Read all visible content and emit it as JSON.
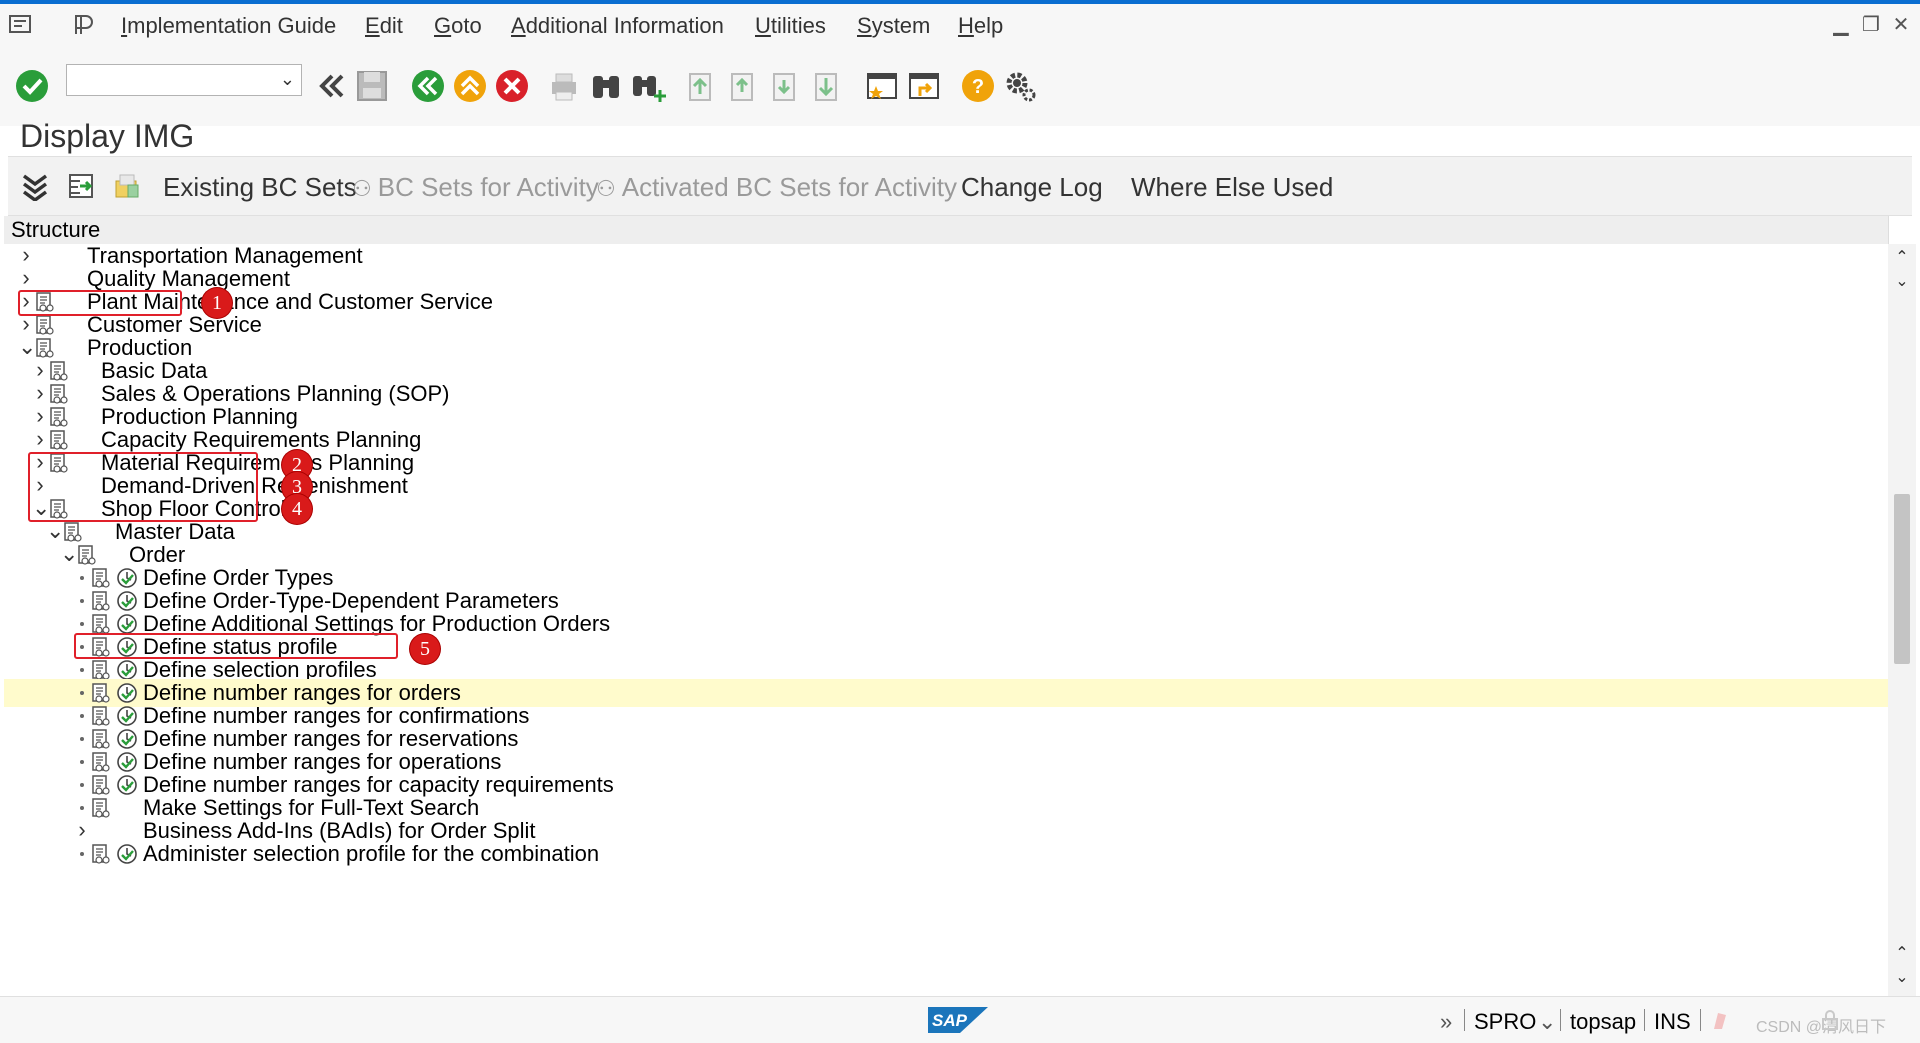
{
  "menu": {
    "items": [
      "Implementation Guide",
      "Edit",
      "Goto",
      "Additional Information",
      "Utilities",
      "System",
      "Help"
    ]
  },
  "icons": {
    "menu_toggle": "menu-icon",
    "sap_menu": "sap-p-icon",
    "enter": "green-check-icon",
    "back": "green-back-icon",
    "exit": "yellow-up-icon",
    "cancel": "red-cancel-icon",
    "help": "yellow-help-icon",
    "settings": "gear-icon"
  },
  "command_field": {
    "value": ""
  },
  "page_title": "Display IMG",
  "app_toolbar": {
    "existing_bc_sets": "Existing BC Sets",
    "bc_sets_for_activity": "BC Sets for Activity",
    "activated_bc_sets": "Activated BC Sets for Activity",
    "change_log": "Change Log",
    "where_else_used": "Where Else Used"
  },
  "structure": {
    "header": "Structure",
    "nodes": [
      {
        "label": "Transportation Management",
        "level": 0,
        "state": "collapsed",
        "doc": false,
        "clock": false
      },
      {
        "label": "Quality Management",
        "level": 0,
        "state": "collapsed",
        "doc": false,
        "clock": false
      },
      {
        "label": "Plant Maintenance and Customer Service",
        "level": 0,
        "state": "collapsed",
        "doc": true,
        "clock": false
      },
      {
        "label": "Customer Service",
        "level": 0,
        "state": "collapsed",
        "doc": true,
        "clock": false
      },
      {
        "label": "Production",
        "level": 0,
        "state": "expanded",
        "doc": true,
        "clock": false
      },
      {
        "label": "Basic Data",
        "level": 1,
        "state": "collapsed",
        "doc": true,
        "clock": false
      },
      {
        "label": "Sales & Operations Planning (SOP)",
        "level": 1,
        "state": "collapsed",
        "doc": true,
        "clock": false
      },
      {
        "label": "Production Planning",
        "level": 1,
        "state": "collapsed",
        "doc": true,
        "clock": false
      },
      {
        "label": "Capacity Requirements Planning",
        "level": 1,
        "state": "collapsed",
        "doc": true,
        "clock": false
      },
      {
        "label": "Material Requirements Planning",
        "level": 1,
        "state": "collapsed",
        "doc": true,
        "clock": false
      },
      {
        "label": "Demand-Driven Replenishment",
        "level": 1,
        "state": "collapsed",
        "doc": false,
        "clock": false
      },
      {
        "label": "Shop Floor Control",
        "level": 1,
        "state": "expanded",
        "doc": true,
        "clock": false
      },
      {
        "label": "Master Data",
        "level": 2,
        "state": "expanded",
        "doc": true,
        "clock": false
      },
      {
        "label": "Order",
        "level": 3,
        "state": "expanded",
        "doc": true,
        "clock": false
      },
      {
        "label": "Define Order Types",
        "level": 4,
        "state": "leaf",
        "doc": true,
        "clock": true
      },
      {
        "label": "Define Order-Type-Dependent Parameters",
        "level": 4,
        "state": "leaf",
        "doc": true,
        "clock": true
      },
      {
        "label": "Define Additional Settings for Production Orders",
        "level": 4,
        "state": "leaf",
        "doc": true,
        "clock": true
      },
      {
        "label": "Define status profile",
        "level": 4,
        "state": "leaf",
        "doc": true,
        "clock": true
      },
      {
        "label": "Define selection profiles",
        "level": 4,
        "state": "leaf",
        "doc": true,
        "clock": true
      },
      {
        "label": "Define number ranges for orders",
        "level": 4,
        "state": "leaf",
        "doc": true,
        "clock": true,
        "selected": true
      },
      {
        "label": "Define number ranges for confirmations",
        "level": 4,
        "state": "leaf",
        "doc": true,
        "clock": true
      },
      {
        "label": "Define number ranges for reservations",
        "level": 4,
        "state": "leaf",
        "doc": true,
        "clock": true
      },
      {
        "label": "Define number ranges for operations",
        "level": 4,
        "state": "leaf",
        "doc": true,
        "clock": true
      },
      {
        "label": "Define number ranges for capacity requirements",
        "level": 4,
        "state": "leaf",
        "doc": true,
        "clock": true
      },
      {
        "label": "Make Settings for Full-Text Search",
        "level": 4,
        "state": "leaf",
        "doc": true,
        "clock": false
      },
      {
        "label": "Business Add-Ins (BAdIs) for Order Split",
        "level": 4,
        "state": "collapsed",
        "doc": false,
        "clock": false
      },
      {
        "label": "Administer selection profile for the combination",
        "level": 4,
        "state": "leaf",
        "doc": true,
        "clock": true
      }
    ]
  },
  "annotations": [
    "1",
    "2",
    "3",
    "4",
    "5"
  ],
  "status": {
    "transaction": "SPRO",
    "server": "topsap",
    "mode": "INS",
    "watermark": "CSDN @清风日下"
  },
  "colors": {
    "highlight_row": "#fffbcc",
    "annotation_red": "#d91a1a",
    "accent_blue": "#0a6ed1",
    "check_green": "#2a9d3a"
  }
}
